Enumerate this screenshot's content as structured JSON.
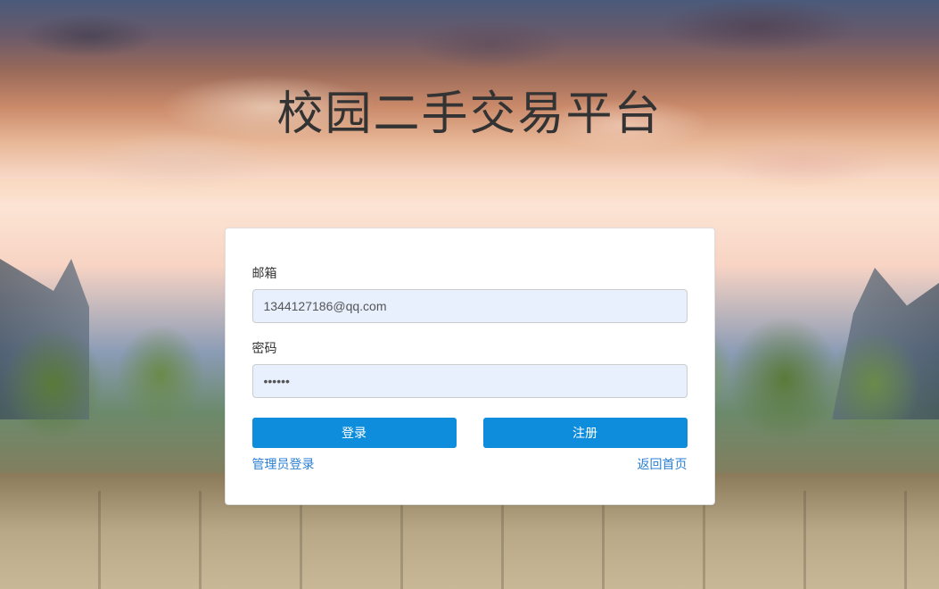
{
  "title": "校园二手交易平台",
  "form": {
    "email_label": "邮箱",
    "email_value": "1344127186@qq.com",
    "password_label": "密码",
    "password_value": "••••••",
    "login_button": "登录",
    "register_button": "注册"
  },
  "links": {
    "admin_login": "管理员登录",
    "back_home": "返回首页"
  }
}
